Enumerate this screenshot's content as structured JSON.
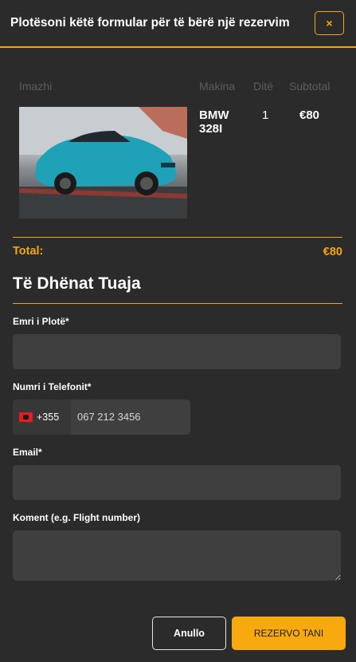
{
  "header": {
    "title": "Plotësoni këtë formular për të bërë një rezervim",
    "close_symbol": "×"
  },
  "table": {
    "columns": [
      "Imazhi",
      "Makina",
      "Ditë",
      "Subtotal"
    ],
    "row": {
      "car": "BMW 328I",
      "days": "1",
      "subtotal": "€80",
      "image_icon": "car-photo"
    }
  },
  "total": {
    "label": "Total:",
    "value": "€80"
  },
  "section": {
    "title": "Të Dhënat Tuaja"
  },
  "form": {
    "name_label": "Emri i Plotë*",
    "name_value": "",
    "phone_label": "Numri i Telefonit*",
    "phone_dial": "+355",
    "phone_value": "067 212 3456",
    "email_label": "Email*",
    "email_value": "",
    "comment_label": "Koment (e.g. Flight number)",
    "comment_value": ""
  },
  "actions": {
    "cancel": "Anullo",
    "submit": "REZERVO TANI"
  },
  "colors": {
    "accent": "#f4a70c",
    "background": "#2b2b2b",
    "field": "#3f3f3f"
  }
}
